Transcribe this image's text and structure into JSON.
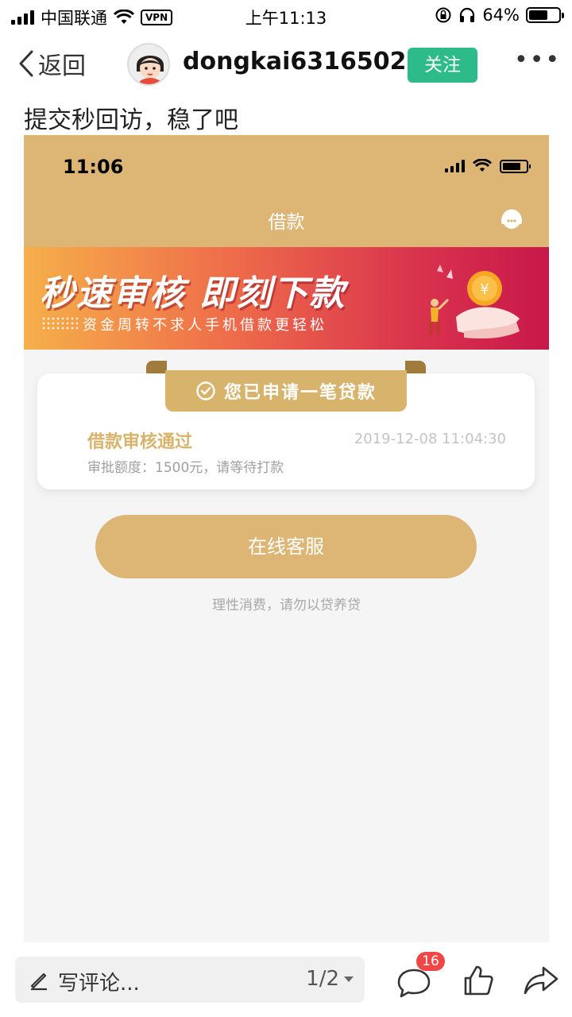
{
  "status_bar": {
    "carrier": "中国联通",
    "vpn": "VPN",
    "time": "上午11:13",
    "battery": "64%",
    "battery_level": 0.64,
    "icons": [
      "signal-icon",
      "wifi-icon",
      "vpn-icon",
      "orientation-lock-icon",
      "headphones-icon",
      "battery-icon"
    ]
  },
  "nav": {
    "back_label": "返回",
    "username": "dongkai6316502",
    "follow_label": "关注",
    "more_label": "•••"
  },
  "post": {
    "text": "提交秒回访，稳了吧"
  },
  "screenshot": {
    "status_time": "11:06",
    "title": "借款",
    "banner": {
      "headline": "秒速审核  即刻下款",
      "subline": "资金周转不求人手机借款更轻松"
    },
    "ribbon": "您已申请一笔贷款",
    "card": {
      "title": "借款审核通过",
      "time": "2019-12-08 11:04:30",
      "subtitle": "审批额度：1500元，请等待打款"
    },
    "service_button": "在线客服",
    "footnote": "理性消费，请勿以贷养贷"
  },
  "bottom_bar": {
    "comment_placeholder": "写评论...",
    "pager": "1/2",
    "comment_count": "16"
  },
  "colors": {
    "gold": "#ddb574",
    "follow_green": "#2dbb8a",
    "badge_red": "#f04646"
  }
}
